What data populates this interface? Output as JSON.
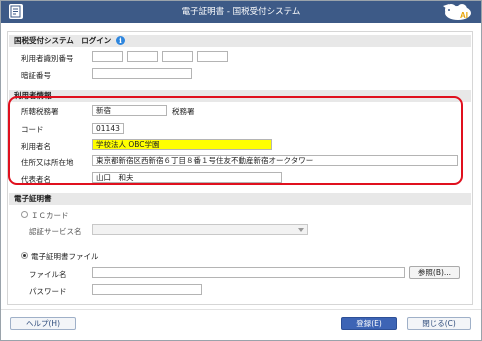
{
  "window": {
    "title": "電子証明書 - 国税受付システム",
    "logo_text": "AI"
  },
  "login": {
    "section_title": "国税受付システム　ログイン",
    "user_id_label": "利用者識別番号",
    "pin_label": "暗証番号",
    "user_id_parts": [
      "",
      "",
      "",
      ""
    ],
    "pin_value": ""
  },
  "user_info": {
    "section_title": "利用者情報",
    "tax_office_label": "所轄税務署",
    "tax_office_value": "新宿",
    "tax_office_suffix": "税務署",
    "code_label": "コード",
    "code_value": "01143",
    "user_name_label": "利用者名",
    "user_name_value": "学校法人 OBC学園",
    "address_label": "住所又は所在地",
    "address_value": "東京都新宿区西新宿６丁目８番１号住友不動産新宿オークタワー",
    "representative_label": "代表者名",
    "representative_value": "山口　和夫",
    "highlight_color": "#e0101e",
    "field_highlight_color": "#ffff00"
  },
  "certificate": {
    "section_title": "電子証明書",
    "ic_card_label": "ＩＣカード",
    "auth_service_label": "認証サービス名",
    "file_option_label": "電子証明書ファイル",
    "file_name_label": "ファイル名",
    "file_name_value": "",
    "browse_button": "参照(B)...",
    "password_label": "パスワード",
    "password_value": "",
    "selected_option": "電子証明書ファイル"
  },
  "footer": {
    "help_button": "ヘルプ(H)",
    "register_button": "登録(E)",
    "close_button": "閉じる(C)"
  },
  "colors": {
    "titlebar": "#3d5a87",
    "primary_button": "#3d64b5"
  }
}
